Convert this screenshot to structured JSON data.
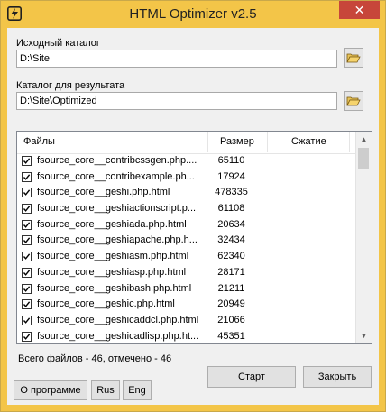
{
  "window": {
    "title": "HTML Optimizer v2.5",
    "close_glyph": "✕",
    "app_icon": "lightning-icon"
  },
  "source": {
    "label": "Исходный каталог",
    "value": "D:\\Site",
    "browse_icon": "open-folder-icon"
  },
  "target": {
    "label": "Каталог для результата",
    "value": "D:\\Site\\Optimized",
    "browse_icon": "open-folder-icon"
  },
  "files": {
    "columns": [
      "Файлы",
      "Размер",
      "Сжатие"
    ],
    "rows": [
      {
        "name": "fsource_core__contribcssgen.php....",
        "size": "65110",
        "compression": "",
        "checked": true
      },
      {
        "name": "fsource_core__contribexample.ph...",
        "size": "17924",
        "compression": "",
        "checked": true
      },
      {
        "name": "fsource_core__geshi.php.html",
        "size": "478335",
        "compression": "",
        "checked": true
      },
      {
        "name": "fsource_core__geshiactionscript.p...",
        "size": "61108",
        "compression": "",
        "checked": true
      },
      {
        "name": "fsource_core__geshiada.php.html",
        "size": "20634",
        "compression": "",
        "checked": true
      },
      {
        "name": "fsource_core__geshiapache.php.h...",
        "size": "32434",
        "compression": "",
        "checked": true
      },
      {
        "name": "fsource_core__geshiasm.php.html",
        "size": "62340",
        "compression": "",
        "checked": true
      },
      {
        "name": "fsource_core__geshiasp.php.html",
        "size": "28171",
        "compression": "",
        "checked": true
      },
      {
        "name": "fsource_core__geshibash.php.html",
        "size": "21211",
        "compression": "",
        "checked": true
      },
      {
        "name": "fsource_core__geshic.php.html",
        "size": "20949",
        "compression": "",
        "checked": true
      },
      {
        "name": "fsource_core__geshicaddcl.php.html",
        "size": "21066",
        "compression": "",
        "checked": true
      },
      {
        "name": "fsource_core__geshicadlisp.php.ht...",
        "size": "45351",
        "compression": "",
        "checked": true
      }
    ]
  },
  "status": "Всего файлов - 46, отмечено - 46",
  "buttons": {
    "start": "Старт",
    "close": "Закрыть",
    "about": "О программе",
    "rus": "Rus",
    "eng": "Eng"
  },
  "colors": {
    "titlebar": "#f3c548",
    "close_button": "#c7463a",
    "client_bg": "#f0f0f0"
  }
}
